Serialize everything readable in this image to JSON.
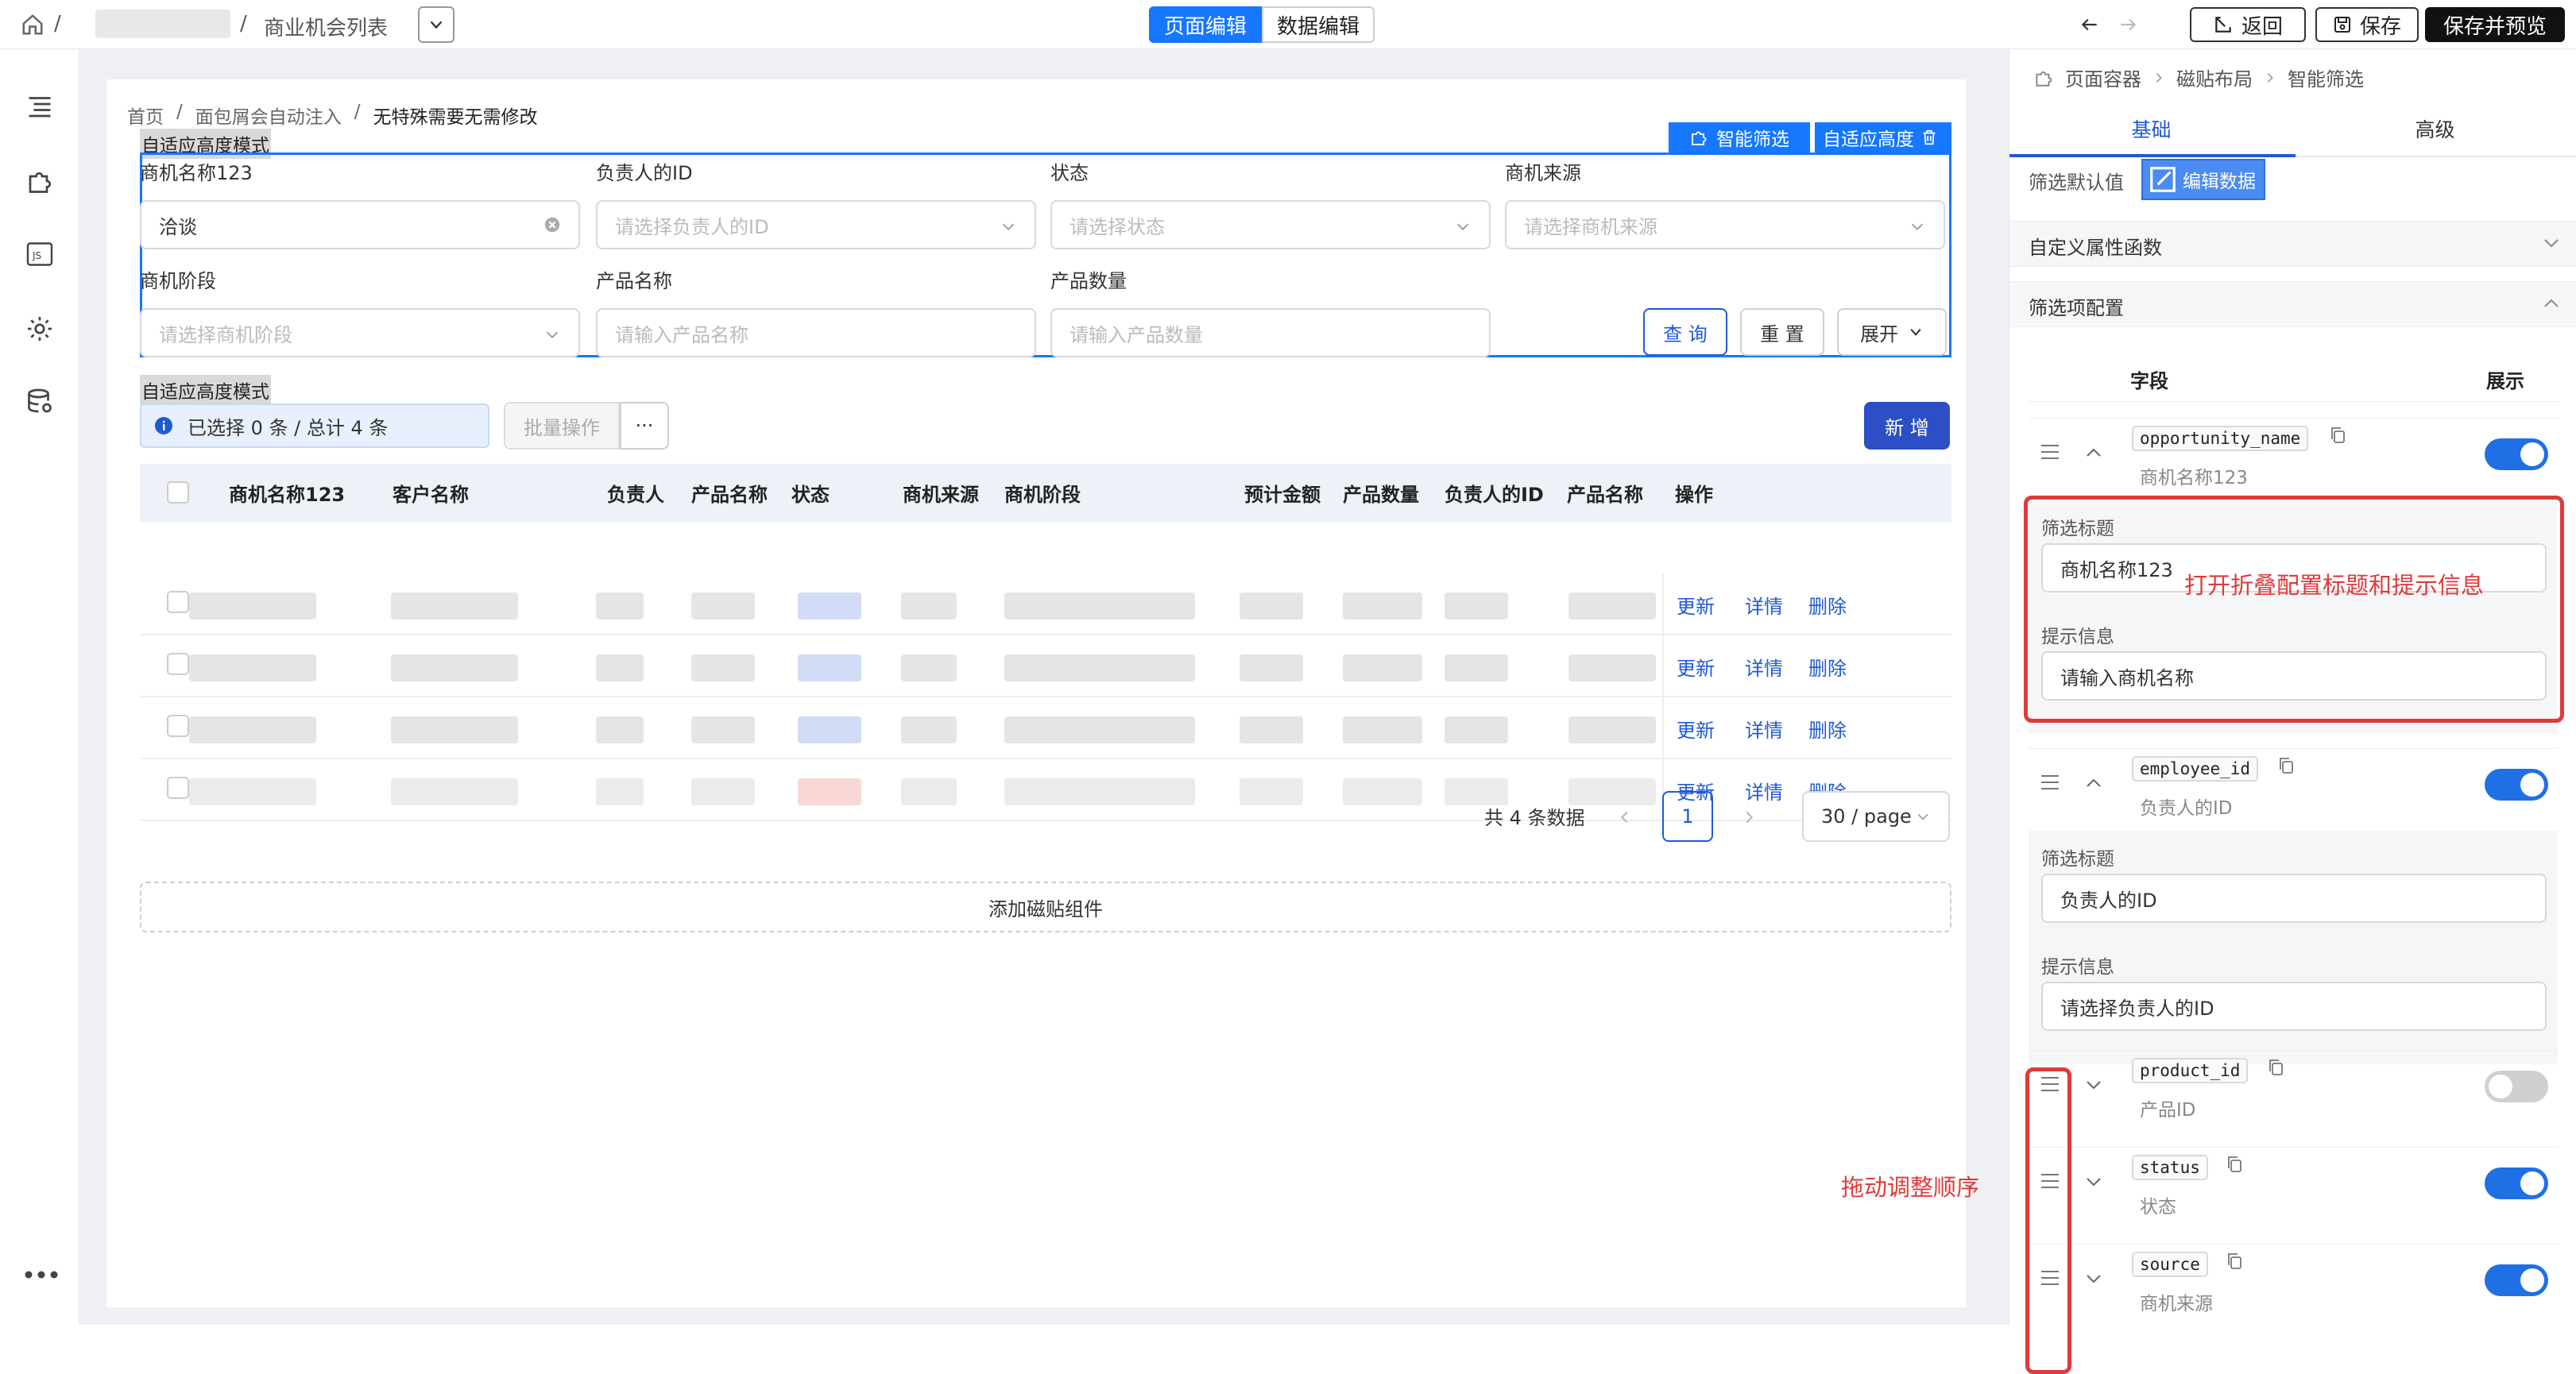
{
  "topbar": {
    "breadcrumb_sep": "/",
    "breadcrumb_current": "商业机会列表",
    "mode_page": "页面编辑",
    "mode_data": "数据编辑",
    "back_label": "返回",
    "save_label": "保存",
    "save_preview_label": "保存并预览",
    "accent": "#1677ff"
  },
  "canvas": {
    "breadcrumb": [
      "首页",
      "面包屑会自动注入",
      "无特殊需要无需修改"
    ],
    "crumb_sep": "/",
    "filter_mode_label": "自适应高度模式",
    "table_mode_label": "自适应高度模式",
    "smart_filter_tag": "智能筛选",
    "adaptive_height_tag": "自适应高度",
    "filters": [
      {
        "label": "商机名称123",
        "value": "洽谈",
        "placeholder": ""
      },
      {
        "label": "负责人的ID",
        "value": "",
        "placeholder": "请选择负责人的ID"
      },
      {
        "label": "状态",
        "value": "",
        "placeholder": "请选择状态"
      },
      {
        "label": "商机来源",
        "value": "",
        "placeholder": "请选择商机来源"
      },
      {
        "label": "商机阶段",
        "value": "",
        "placeholder": "请选择商机阶段"
      },
      {
        "label": "产品名称",
        "value": "",
        "placeholder": "请输入产品名称"
      },
      {
        "label": "产品数量",
        "value": "",
        "placeholder": "请输入产品数量"
      }
    ],
    "query_button": "查 询",
    "reset_button": "重 置",
    "expand_button": "展开",
    "selection_info": "已选择 0 条 / 总计 4 条",
    "batch_button": "批量操作",
    "more_button": "···",
    "add_button": "新 增",
    "table_headers": [
      "商机名称123",
      "客户名称",
      "负责人",
      "产品名称",
      "状态",
      "商机来源",
      "商机阶段",
      "预计金额",
      "产品数量",
      "负责人的ID",
      "产品名称",
      "操作"
    ],
    "row_actions": [
      "更新",
      "详情",
      "删除"
    ],
    "row_count": 4,
    "total_text": "共 4 条数据",
    "current_page": "1",
    "page_size": "30 / page",
    "add_tile_label": "添加磁贴组件"
  },
  "panel": {
    "breadcrumb": [
      "页面容器",
      "磁贴布局",
      "智能筛选"
    ],
    "tabs": [
      "基础",
      "高级"
    ],
    "active_tab": "基础",
    "filter_default_label": "筛选默认值",
    "edit_data_button": "编辑数据",
    "custom_attr_section": "自定义属性函数",
    "filter_config_section": "筛选项配置",
    "col_field": "字段",
    "col_show": "展示",
    "title_label": "筛选标题",
    "hint_label": "提示信息",
    "fields": [
      {
        "code": "opportunity_name",
        "label": "商机名称123",
        "expanded": true,
        "shown": true,
        "title": "商机名称123",
        "hint": "请输入商机名称"
      },
      {
        "code": "employee_id",
        "label": "负责人的ID",
        "expanded": true,
        "shown": true,
        "title": "负责人的ID",
        "hint": "请选择负责人的ID"
      },
      {
        "code": "product_id",
        "label": "产品ID",
        "expanded": false,
        "shown": false
      },
      {
        "code": "status",
        "label": "状态",
        "expanded": false,
        "shown": true
      },
      {
        "code": "source",
        "label": "商机来源",
        "expanded": false,
        "shown": true
      }
    ],
    "annotation_expand": "打开折叠配置标题和提示信息",
    "annotation_drag": "拖动调整顺序"
  }
}
